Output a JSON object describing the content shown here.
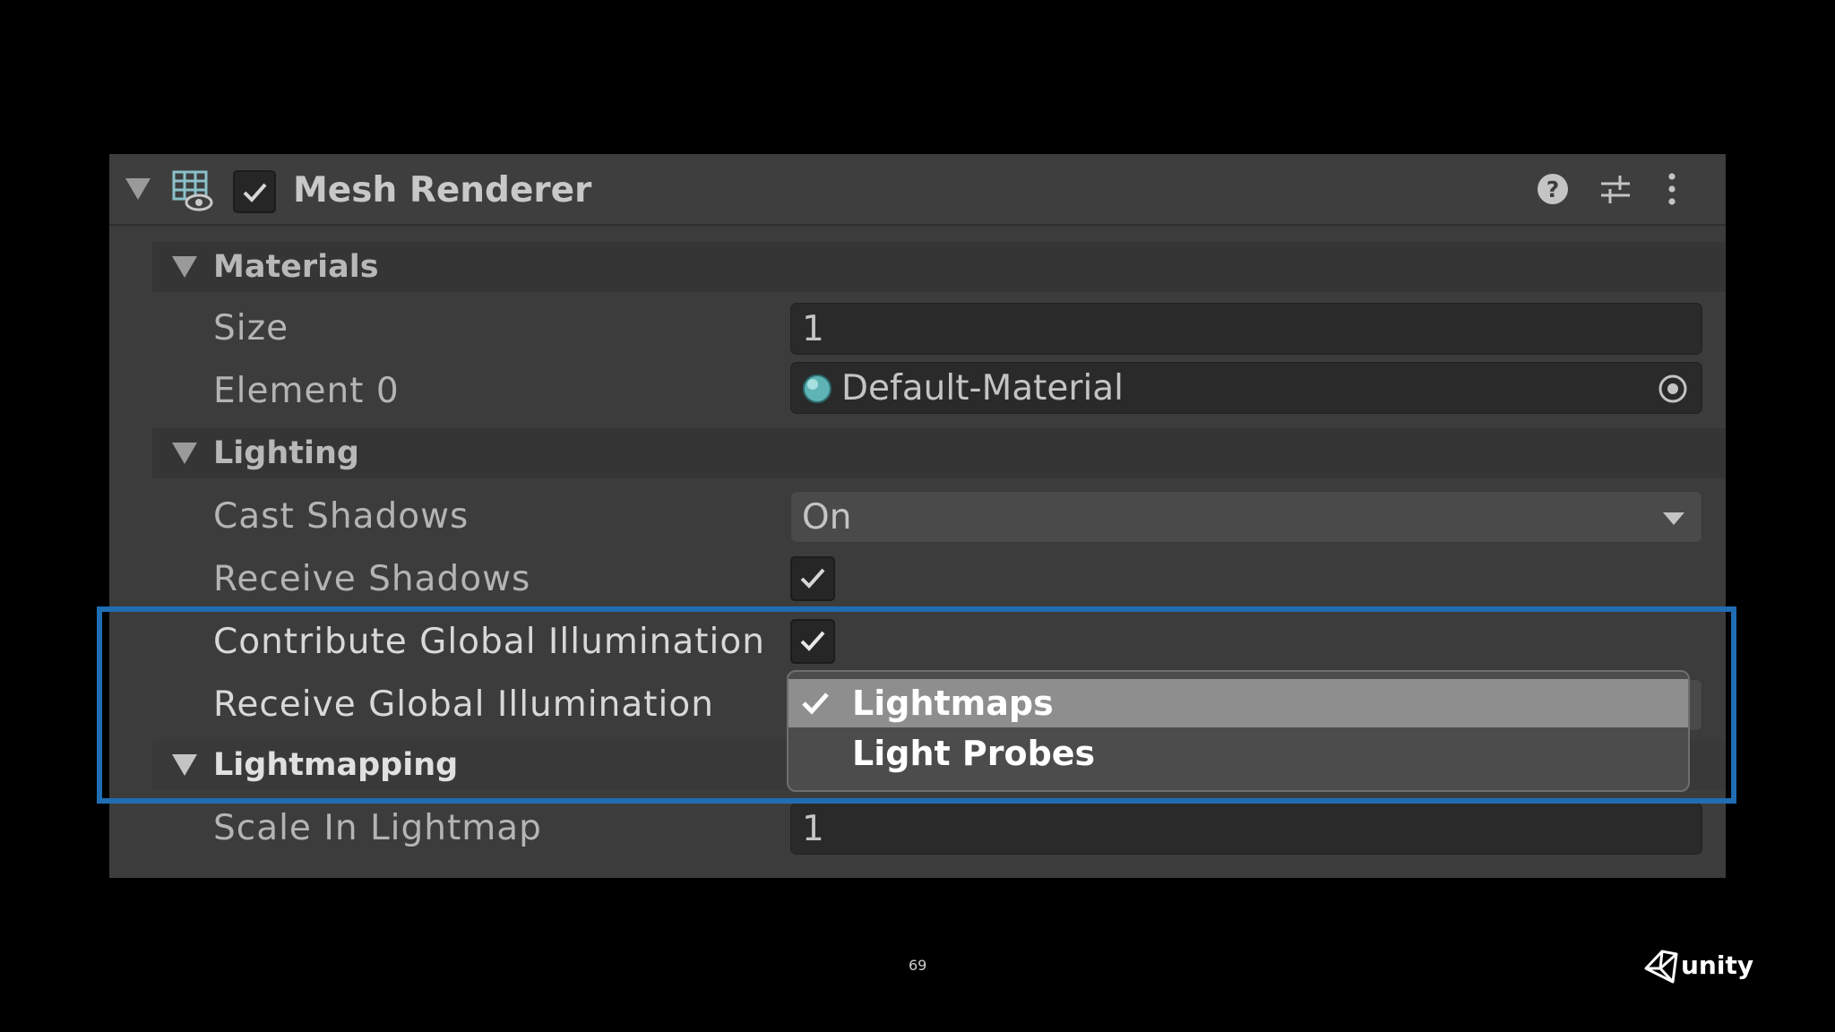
{
  "component": {
    "title": "Mesh Renderer",
    "icons": [
      "collapse-arrow-icon",
      "mesh-renderer-icon",
      "help-icon",
      "preset-icon",
      "kebab-menu-icon"
    ]
  },
  "sections": {
    "materials": "Materials",
    "lighting": "Lighting",
    "lightmapping": "Lightmapping"
  },
  "properties": {
    "size": {
      "label": "Size",
      "value": "1"
    },
    "element0": {
      "label": "Element 0",
      "value": "Default-Material"
    },
    "cast_shadows": {
      "label": "Cast Shadows",
      "value": "On"
    },
    "receive_shadows": {
      "label": "Receive Shadows",
      "checked": true
    },
    "contribute_gi": {
      "label": "Contribute Global Illumination",
      "checked": true
    },
    "receive_gi": {
      "label": "Receive Global Illumination"
    },
    "scale_in_lightmap": {
      "label": "Scale In Lightmap",
      "value": "1"
    }
  },
  "popup": {
    "options": [
      {
        "label": "Lightmaps",
        "selected": true
      },
      {
        "label": "Light Probes",
        "selected": false
      }
    ]
  },
  "colors": {
    "highlight": "#1f6db3",
    "panel": "#3c3c3c",
    "popup_selected": "#8e8e8e"
  },
  "footer": {
    "page_number": "69",
    "brand": "unity"
  }
}
